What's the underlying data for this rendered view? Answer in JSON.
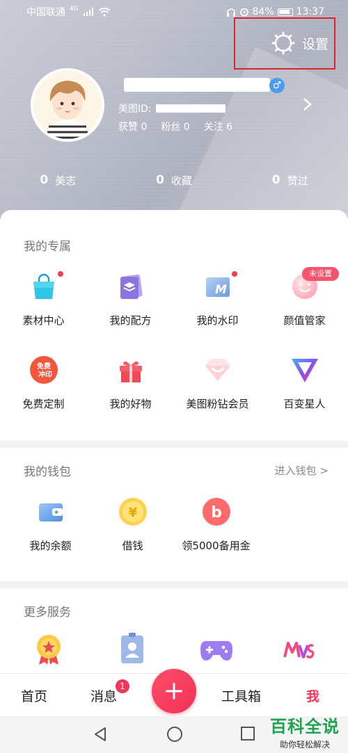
{
  "status_bar": {
    "carrier": "中国联通",
    "network": "4G",
    "battery": "84%",
    "time": "13:37"
  },
  "header": {
    "settings_label": "设置",
    "meitu_id_label": "美图ID:",
    "likes_label": "获赞 0",
    "fans_label": "粉丝 0",
    "follow_label": "关注 6",
    "gender_symbol": "♂",
    "counters": [
      {
        "num": "0",
        "label": "美志"
      },
      {
        "num": "0",
        "label": "收藏"
      },
      {
        "num": "0",
        "label": "赞过"
      }
    ]
  },
  "exclusive": {
    "title": "我的专属",
    "badge_unset": "未设置",
    "items": [
      {
        "label": "素材中心",
        "icon": "shopping-bag-icon"
      },
      {
        "label": "我的配方",
        "icon": "recipe-layers-icon"
      },
      {
        "label": "我的水印",
        "icon": "watermark-icon"
      },
      {
        "label": "颜值管家",
        "icon": "smile-face-icon"
      },
      {
        "label": "免费定制",
        "icon": "free-print-icon",
        "icon_text_1": "免费",
        "icon_text_2": "冲印"
      },
      {
        "label": "我的好物",
        "icon": "gift-box-icon"
      },
      {
        "label": "美图粉钻会员",
        "icon": "pink-diamond-icon"
      },
      {
        "label": "百变星人",
        "icon": "gradient-triangle-icon"
      }
    ]
  },
  "wallet": {
    "title": "我的钱包",
    "enter_link": "进入钱包 >",
    "items": [
      {
        "label": "我的余额",
        "icon": "wallet-icon"
      },
      {
        "label": "借钱",
        "icon": "yen-coin-icon",
        "icon_glyph": "¥"
      },
      {
        "label": "领5000备用金",
        "icon": "b-circle-icon",
        "icon_glyph": "b"
      }
    ]
  },
  "more": {
    "title": "更多服务"
  },
  "tab_bar": {
    "home": "首页",
    "messages": "消息",
    "message_badge": "1",
    "toolbox": "工具箱",
    "me": "我"
  },
  "watermark": {
    "title": "百科全说",
    "subtitle": "助你轻松解决"
  },
  "colors": {
    "accent": "#f5365c",
    "highlight_box": "#e0232a"
  }
}
